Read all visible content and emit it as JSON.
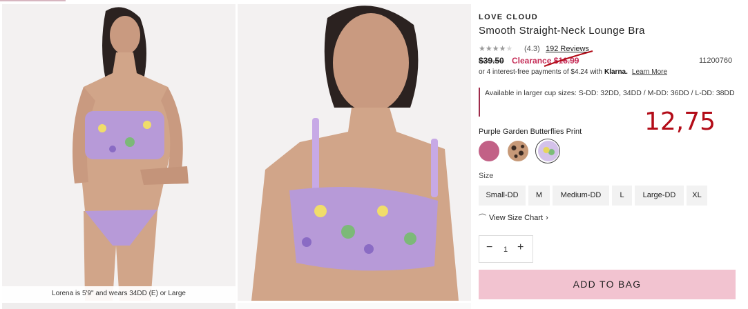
{
  "photos": {
    "caption": "Lorena is 5'9\" and wears 34DD (E) or Large"
  },
  "product": {
    "brand": "LOVE CLOUD",
    "title": "Smooth Straight-Neck Lounge Bra",
    "rating_text": "(4.3)",
    "rating_value": 4.3,
    "reviews_link": "192 Reviews",
    "original_price": "$39.50",
    "sale_label": "Clearance",
    "sale_price": "$16.99",
    "sku": "11200760",
    "klarna_prefix": "or 4 interest-free payments of $4.24 with",
    "klarna_brand": "Klarna.",
    "klarna_learn": "Learn More",
    "cup_note": "Available in larger cup sizes: S-DD: 32DD, 34DD / M-DD: 36DD / L-DD: 38DD"
  },
  "annotation": {
    "handwritten_price": "12,75",
    "color": "#b30c18"
  },
  "color": {
    "label": "Purple Garden Butterflies Print",
    "swatches": [
      "pink",
      "leopard",
      "purple-floral-selected"
    ]
  },
  "size": {
    "label": "Size",
    "options": [
      "Small-DD",
      "M",
      "Medium-DD",
      "L",
      "Large-DD",
      "XL"
    ],
    "chart_link": "View Size Chart"
  },
  "quantity": {
    "value": "1",
    "minus": "−",
    "plus": "+"
  },
  "cta": {
    "add_to_bag": "ADD TO BAG"
  },
  "colors": {
    "accent_pink": "#f2c3d0",
    "sale_red": "#c52d57"
  }
}
